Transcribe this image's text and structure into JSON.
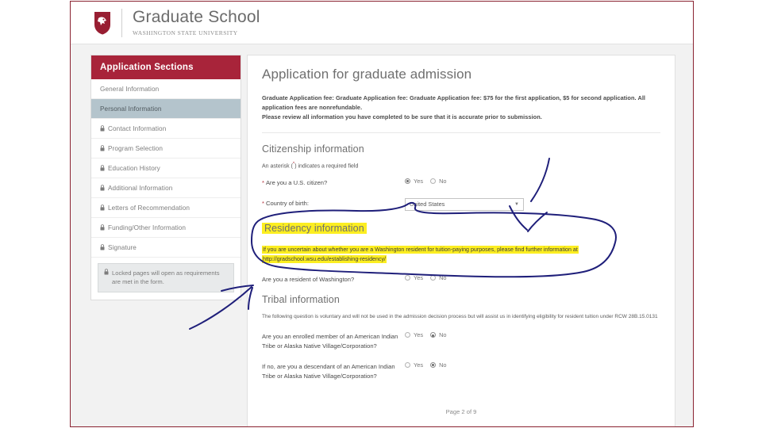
{
  "header": {
    "logo_icon": "wsu-cougar-shield-icon",
    "title": "Graduate School",
    "subtitle": "WASHINGTON STATE UNIVERSITY"
  },
  "sidebar": {
    "heading": "Application Sections",
    "items": [
      {
        "label": "General Information",
        "locked": false,
        "active": false
      },
      {
        "label": "Personal Information",
        "locked": false,
        "active": true
      },
      {
        "label": "Contact Information",
        "locked": true,
        "active": false
      },
      {
        "label": "Program Selection",
        "locked": true,
        "active": false
      },
      {
        "label": "Education History",
        "locked": true,
        "active": false
      },
      {
        "label": "Additional Information",
        "locked": true,
        "active": false
      },
      {
        "label": "Letters of Recommendation",
        "locked": true,
        "active": false
      },
      {
        "label": "Funding/Other Information",
        "locked": true,
        "active": false
      },
      {
        "label": "Signature",
        "locked": true,
        "active": false
      }
    ],
    "note": "Locked pages will open as requirements are met in the form."
  },
  "main": {
    "title": "Application for graduate admission",
    "fee_line_1": "Graduate Application fee: Graduate Application fee: Graduate Application fee: $75 for the first application, $5 for second application. All application fees are nonrefundable.",
    "fee_line_2": "Please review all information you have completed to be sure that it is accurate prior to submission.",
    "citizenship": {
      "heading": "Citizenship information",
      "asterisk_note_pre": "An asterisk (",
      "asterisk_note_mark": "*",
      "asterisk_note_post": ") indicates a required field",
      "q_citizen_label": "Are you a U.S. citizen?",
      "q_citizen_yes": "Yes",
      "q_citizen_no": "No",
      "q_citizen_value": "Yes",
      "q_country_label": "Country of birth:",
      "q_country_value": "United States"
    },
    "residency": {
      "heading": "Residency information",
      "note_text": "If you are uncertain about whether you are a Washington resident for tuition-paying purposes, please find further information at",
      "note_url": "http://gradschool.wsu.edu/establishing-residency/",
      "q_resident_label": "Are you a resident of Washington?",
      "q_resident_yes": "Yes",
      "q_resident_no": "No",
      "q_resident_value": ""
    },
    "tribal": {
      "heading": "Tribal information",
      "note": "The following question is voluntary and will not be used in the admission decision process but will assist us in identifying eligibility for resident tuition under RCW 28B.15.0131",
      "q1_label": "Are you an enrolled member of an American Indian Tribe or Alaska Native Village/Corporation?",
      "q1_yes": "Yes",
      "q1_no": "No",
      "q1_value": "No",
      "q2_label": "If no, are you a descendant of an American Indian Tribe or Alaska Native Village/Corporation?",
      "q2_yes": "Yes",
      "q2_no": "No",
      "q2_value": "No"
    },
    "footer": "Page 2 of 9"
  },
  "annotations": {
    "ink_color": "#1f1f7a",
    "highlight_color": "#fcee21",
    "brand_crimson": "#a8243a"
  }
}
